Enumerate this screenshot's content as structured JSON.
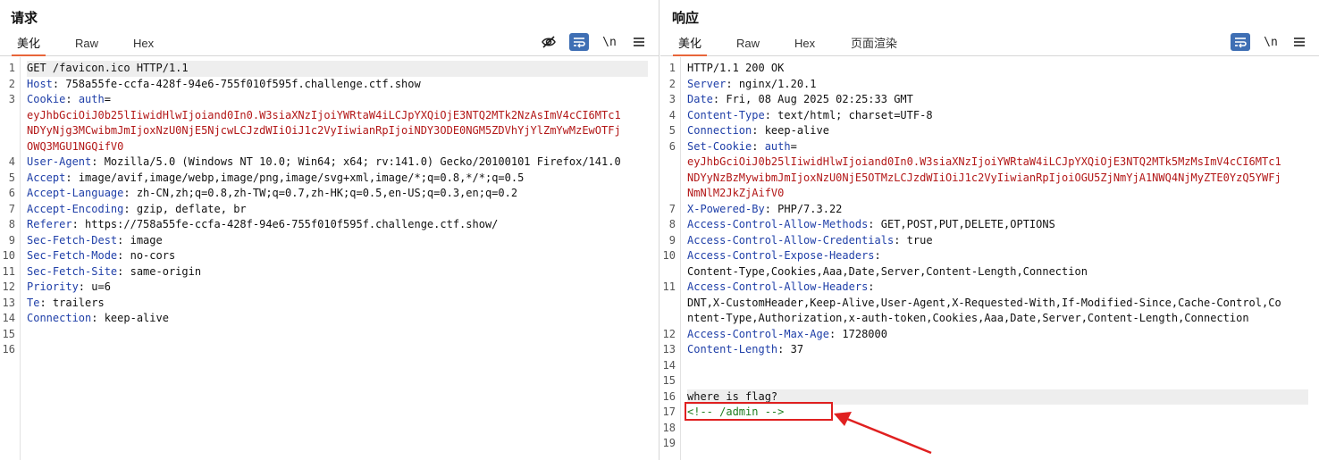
{
  "request": {
    "title": "请求",
    "tabs": [
      "美化",
      "Raw",
      "Hex"
    ],
    "active_tab": "美化",
    "lines": [
      {
        "n": "1",
        "parts": [
          {
            "t": "GET /favicon.ico HTTP/1.1",
            "c": "val"
          }
        ],
        "hl": true
      },
      {
        "n": "2",
        "parts": [
          {
            "t": "Host",
            "c": "key"
          },
          {
            "t": ": ",
            "c": "sep"
          },
          {
            "t": "758a55fe-ccfa-428f-94e6-755f010f595f.challenge.ctf.show",
            "c": "val"
          }
        ]
      },
      {
        "n": "3",
        "parts": [
          {
            "t": "Cookie",
            "c": "key"
          },
          {
            "t": ": ",
            "c": "sep"
          },
          {
            "t": "auth",
            "c": "key"
          },
          {
            "t": "=",
            "c": "sep"
          }
        ]
      },
      {
        "n": "",
        "parts": [
          {
            "t": "eyJhbGciOiJ0b25lIiwidHlwIjoiand0In0.W3siaXNzIjoiYWRtaW4iLCJpYXQiOjE3NTQ2MTk2NzAsImV4cCI6MTc1",
            "c": "cookie"
          }
        ]
      },
      {
        "n": "",
        "parts": [
          {
            "t": "NDYyNjg3MCwibmJmIjoxNzU0NjE5NjcwLCJzdWIiOiJ1c2VyIiwianRpIjoiNDY3ODE0NGM5ZDVhYjYlZmYwMzEwOTFj",
            "c": "cookie"
          }
        ]
      },
      {
        "n": "",
        "parts": [
          {
            "t": "OWQ3MGU1NGQifV0",
            "c": "cookie"
          }
        ]
      },
      {
        "n": "4",
        "parts": [
          {
            "t": "User-Agent",
            "c": "key"
          },
          {
            "t": ": ",
            "c": "sep"
          },
          {
            "t": "Mozilla/5.0 (Windows NT 10.0; Win64; x64; rv:141.0) Gecko/20100101 Firefox/141.0",
            "c": "val"
          }
        ]
      },
      {
        "n": "5",
        "parts": [
          {
            "t": "Accept",
            "c": "key"
          },
          {
            "t": ": ",
            "c": "sep"
          },
          {
            "t": "image/avif,image/webp,image/png,image/svg+xml,image/*;q=0.8,*/*;q=0.5",
            "c": "val"
          }
        ]
      },
      {
        "n": "6",
        "parts": [
          {
            "t": "Accept-Language",
            "c": "key"
          },
          {
            "t": ": ",
            "c": "sep"
          },
          {
            "t": "zh-CN,zh;q=0.8,zh-TW;q=0.7,zh-HK;q=0.5,en-US;q=0.3,en;q=0.2",
            "c": "val"
          }
        ]
      },
      {
        "n": "7",
        "parts": [
          {
            "t": "Accept-Encoding",
            "c": "key"
          },
          {
            "t": ": ",
            "c": "sep"
          },
          {
            "t": "gzip, deflate, br",
            "c": "val"
          }
        ]
      },
      {
        "n": "8",
        "parts": [
          {
            "t": "Referer",
            "c": "key"
          },
          {
            "t": ": ",
            "c": "sep"
          },
          {
            "t": "https://758a55fe-ccfa-428f-94e6-755f010f595f.challenge.ctf.show/",
            "c": "val"
          }
        ]
      },
      {
        "n": "9",
        "parts": [
          {
            "t": "Sec-Fetch-Dest",
            "c": "key"
          },
          {
            "t": ": ",
            "c": "sep"
          },
          {
            "t": "image",
            "c": "val"
          }
        ]
      },
      {
        "n": "10",
        "parts": [
          {
            "t": "Sec-Fetch-Mode",
            "c": "key"
          },
          {
            "t": ": ",
            "c": "sep"
          },
          {
            "t": "no-cors",
            "c": "val"
          }
        ]
      },
      {
        "n": "11",
        "parts": [
          {
            "t": "Sec-Fetch-Site",
            "c": "key"
          },
          {
            "t": ": ",
            "c": "sep"
          },
          {
            "t": "same-origin",
            "c": "val"
          }
        ]
      },
      {
        "n": "12",
        "parts": [
          {
            "t": "Priority",
            "c": "key"
          },
          {
            "t": ": ",
            "c": "sep"
          },
          {
            "t": "u=6",
            "c": "val"
          }
        ]
      },
      {
        "n": "13",
        "parts": [
          {
            "t": "Te",
            "c": "key"
          },
          {
            "t": ": ",
            "c": "sep"
          },
          {
            "t": "trailers",
            "c": "val"
          }
        ]
      },
      {
        "n": "14",
        "parts": [
          {
            "t": "Connection",
            "c": "key"
          },
          {
            "t": ": ",
            "c": "sep"
          },
          {
            "t": "keep-alive",
            "c": "val"
          }
        ]
      },
      {
        "n": "15",
        "parts": []
      },
      {
        "n": "16",
        "parts": []
      }
    ]
  },
  "response": {
    "title": "响应",
    "tabs": [
      "美化",
      "Raw",
      "Hex",
      "页面渲染"
    ],
    "active_tab": "美化",
    "lines": [
      {
        "n": "1",
        "parts": [
          {
            "t": "HTTP/1.1 200 OK",
            "c": "val"
          }
        ]
      },
      {
        "n": "2",
        "parts": [
          {
            "t": "Server",
            "c": "key"
          },
          {
            "t": ": ",
            "c": "sep"
          },
          {
            "t": "nginx/1.20.1",
            "c": "val"
          }
        ]
      },
      {
        "n": "3",
        "parts": [
          {
            "t": "Date",
            "c": "key"
          },
          {
            "t": ": ",
            "c": "sep"
          },
          {
            "t": "Fri, 08 Aug 2025 02:25:33 GMT",
            "c": "val"
          }
        ]
      },
      {
        "n": "4",
        "parts": [
          {
            "t": "Content-Type",
            "c": "key"
          },
          {
            "t": ": ",
            "c": "sep"
          },
          {
            "t": "text/html; charset=UTF-8",
            "c": "val"
          }
        ]
      },
      {
        "n": "5",
        "parts": [
          {
            "t": "Connection",
            "c": "key"
          },
          {
            "t": ": ",
            "c": "sep"
          },
          {
            "t": "keep-alive",
            "c": "val"
          }
        ]
      },
      {
        "n": "6",
        "parts": [
          {
            "t": "Set-Cookie",
            "c": "key"
          },
          {
            "t": ": ",
            "c": "sep"
          },
          {
            "t": "auth",
            "c": "key"
          },
          {
            "t": "=",
            "c": "sep"
          }
        ]
      },
      {
        "n": "",
        "parts": [
          {
            "t": "eyJhbGciOiJ0b25lIiwidHlwIjoiand0In0.W3siaXNzIjoiYWRtaW4iLCJpYXQiOjE3NTQ2MTk5MzMsImV4cCI6MTc1",
            "c": "cookie"
          }
        ]
      },
      {
        "n": "",
        "parts": [
          {
            "t": "NDYyNzBzMywibmJmIjoxNzU0NjE5OTMzLCJzdWIiOiJ1c2VyIiwianRpIjoiOGU5ZjNmYjA1NWQ4NjMyZTE0YzQ5YWFj",
            "c": "cookie"
          }
        ]
      },
      {
        "n": "",
        "parts": [
          {
            "t": "NmNlM2JkZjAifV0",
            "c": "cookie"
          }
        ]
      },
      {
        "n": "7",
        "parts": [
          {
            "t": "X-Powered-By",
            "c": "key"
          },
          {
            "t": ": ",
            "c": "sep"
          },
          {
            "t": "PHP/7.3.22",
            "c": "val"
          }
        ]
      },
      {
        "n": "8",
        "parts": [
          {
            "t": "Access-Control-Allow-Methods",
            "c": "key"
          },
          {
            "t": ": ",
            "c": "sep"
          },
          {
            "t": "GET,POST,PUT,DELETE,OPTIONS",
            "c": "val"
          }
        ]
      },
      {
        "n": "9",
        "parts": [
          {
            "t": "Access-Control-Allow-Credentials",
            "c": "key"
          },
          {
            "t": ": ",
            "c": "sep"
          },
          {
            "t": "true",
            "c": "val"
          }
        ]
      },
      {
        "n": "10",
        "parts": [
          {
            "t": "Access-Control-Expose-Headers",
            "c": "key"
          },
          {
            "t": ":",
            "c": "sep"
          }
        ]
      },
      {
        "n": "",
        "parts": [
          {
            "t": "Content-Type,Cookies,Aaa,Date,Server,Content-Length,Connection",
            "c": "cont"
          }
        ]
      },
      {
        "n": "11",
        "parts": [
          {
            "t": "Access-Control-Allow-Headers",
            "c": "key"
          },
          {
            "t": ":",
            "c": "sep"
          }
        ]
      },
      {
        "n": "",
        "parts": [
          {
            "t": "DNT,X-CustomHeader,Keep-Alive,User-Agent,X-Requested-With,If-Modified-Since,Cache-Control,Co",
            "c": "cont"
          }
        ]
      },
      {
        "n": "",
        "parts": [
          {
            "t": "ntent-Type,Authorization,x-auth-token,Cookies,Aaa,Date,Server,Content-Length,Connection",
            "c": "cont"
          }
        ]
      },
      {
        "n": "12",
        "parts": [
          {
            "t": "Access-Control-Max-Age",
            "c": "key"
          },
          {
            "t": ": ",
            "c": "sep"
          },
          {
            "t": "1728000",
            "c": "val"
          }
        ]
      },
      {
        "n": "13",
        "parts": [
          {
            "t": "Content-Length",
            "c": "key"
          },
          {
            "t": ": ",
            "c": "sep"
          },
          {
            "t": "37",
            "c": "val"
          }
        ]
      },
      {
        "n": "14",
        "parts": []
      },
      {
        "n": "15",
        "parts": []
      },
      {
        "n": "16",
        "parts": [
          {
            "t": "where is flag?",
            "c": "val"
          }
        ],
        "hl": true
      },
      {
        "n": "17",
        "parts": [
          {
            "t": "<!-- /admin -->",
            "c": "comment"
          }
        ]
      },
      {
        "n": "18",
        "parts": []
      },
      {
        "n": "19",
        "parts": []
      }
    ]
  },
  "colors": {
    "accent": "#e8653a",
    "key": "#1f3fa8",
    "cookie": "#b31818",
    "comment": "#1e7d1e",
    "annotation": "#e02020",
    "button": "#3f6fb4"
  },
  "icons": [
    "eye-off-icon",
    "wrap-icon",
    "newline-icon",
    "menu-icon"
  ]
}
